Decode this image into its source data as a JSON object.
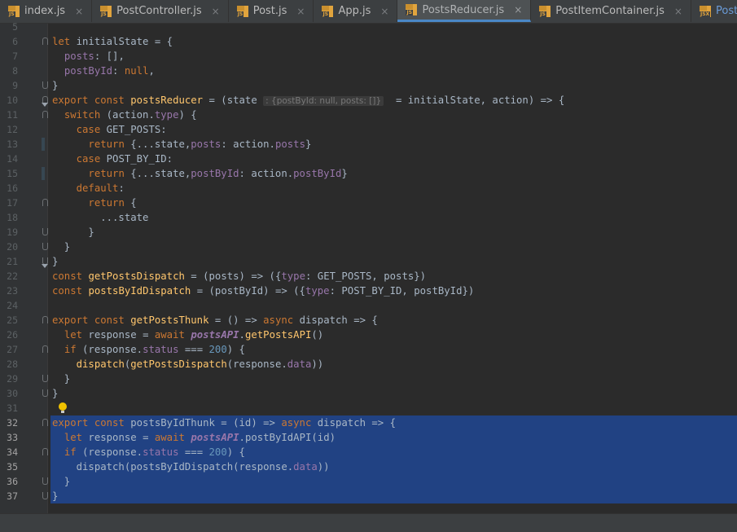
{
  "tabs": [
    {
      "name": "index.js",
      "ext": "JS",
      "active": false
    },
    {
      "name": "PostController.js",
      "ext": "JS",
      "active": false
    },
    {
      "name": "Post.js",
      "ext": "JS",
      "active": false
    },
    {
      "name": "App.js",
      "ext": "JS",
      "active": false
    },
    {
      "name": "PostsReducer.js",
      "ext": "JS",
      "active": true
    },
    {
      "name": "PostItemContainer.js",
      "ext": "JS",
      "active": false
    },
    {
      "name": "PostItem.jsx",
      "ext": "JSX",
      "active": false
    }
  ],
  "close_glyph": "×",
  "inlay_hint": ": {postById: null, posts: []}",
  "lines": [
    {
      "n": "5",
      "html": ""
    },
    {
      "n": "6",
      "html": "<span class='kw'>let</span> initialState = {"
    },
    {
      "n": "7",
      "html": "  <span class='prop'>posts</span>: [],"
    },
    {
      "n": "8",
      "html": "  <span class='prop'>postById</span>: <span class='kw'>null</span>,"
    },
    {
      "n": "9",
      "html": "}"
    },
    {
      "n": "10",
      "html": "<span class='kw'>export const</span> <span class='fn'>postsReducer</span> = (state <span class='hint'>: {postById: null, posts: []}</span>  = initialState, action) => {"
    },
    {
      "n": "11",
      "html": "  <span class='kw'>switch</span> (action.<span class='prop'>type</span>) {"
    },
    {
      "n": "12",
      "html": "    <span class='kw'>case</span> GET_POSTS:"
    },
    {
      "n": "13",
      "html": "      <span class='kw'>return</span> {...state,<span class='prop'>posts</span>: action.<span class='prop'>posts</span>}"
    },
    {
      "n": "14",
      "html": "    <span class='kw'>case</span> POST_BY_ID:"
    },
    {
      "n": "15",
      "html": "      <span class='kw'>return</span> {...state,<span class='prop'>postById</span>: action.<span class='prop'>postById</span>}"
    },
    {
      "n": "16",
      "html": "    <span class='kw'>default</span>:"
    },
    {
      "n": "17",
      "html": "      <span class='kw'>return</span> {"
    },
    {
      "n": "18",
      "html": "        ...state"
    },
    {
      "n": "19",
      "html": "      }"
    },
    {
      "n": "20",
      "html": "  }"
    },
    {
      "n": "21",
      "html": "}"
    },
    {
      "n": "22",
      "html": "<span class='kw'>const</span> <span class='fn'>getPostsDispatch</span> = (posts) => ({<span class='prop'>type</span>: GET_POSTS, posts})"
    },
    {
      "n": "23",
      "html": "<span class='kw'>const</span> <span class='fn'>postsByIdDispatch</span> = (postById) => ({<span class='prop'>type</span>: POST_BY_ID, postById})"
    },
    {
      "n": "24",
      "html": ""
    },
    {
      "n": "25",
      "html": "<span class='kw'>export const</span> <span class='fn'>getPostsThunk</span> = () => <span class='kw'>async</span> dispatch => {"
    },
    {
      "n": "26",
      "html": "  <span class='kw'>let</span> response = <span class='kw'>await</span> <span class='api'>postsAPI</span>.<span class='fn'>getPostsAPI</span>()"
    },
    {
      "n": "27",
      "html": "  <span class='kw'>if</span> (response.<span class='prop'>status</span> === <span class='num'>200</span>) {"
    },
    {
      "n": "28",
      "html": "    <span class='fn'>dispatch</span>(<span class='fn'>getPostsDispatch</span>(response.<span class='prop'>data</span>))"
    },
    {
      "n": "29",
      "html": "  }"
    },
    {
      "n": "30",
      "html": "}"
    },
    {
      "n": "31",
      "html": ""
    },
    {
      "n": "32",
      "html": "<span class='kw'>export const</span> postsByIdThunk = (id) => <span class='kw'>async</span> dispatch => {"
    },
    {
      "n": "33",
      "html": "  <span class='kw'>let</span> response = <span class='kw'>await</span> <span class='api'>postsAPI</span>.postByIdAPI(id)"
    },
    {
      "n": "34",
      "html": "  <span class='kw'>if</span> (response.<span class='prop'>status</span> === <span class='num'>200</span>) {"
    },
    {
      "n": "35",
      "html": "    dispatch(postsByIdDispatch(response.<span class='prop'>data</span>))"
    },
    {
      "n": "36",
      "html": "  }"
    },
    {
      "n": "37",
      "html": "}"
    }
  ],
  "selected_lines": [
    "32",
    "33",
    "34",
    "35",
    "36",
    "37"
  ],
  "colors": {
    "background": "#2b2b2b",
    "keyword": "#cc7832",
    "function": "#ffc66d",
    "property": "#9876aa",
    "number": "#6897bb",
    "selection": "#214283",
    "text": "#a9b7c6"
  },
  "icons": {
    "file_icon": "js-file-icon",
    "intention": "lightbulb-icon",
    "fold": "fold-marker-icon"
  }
}
